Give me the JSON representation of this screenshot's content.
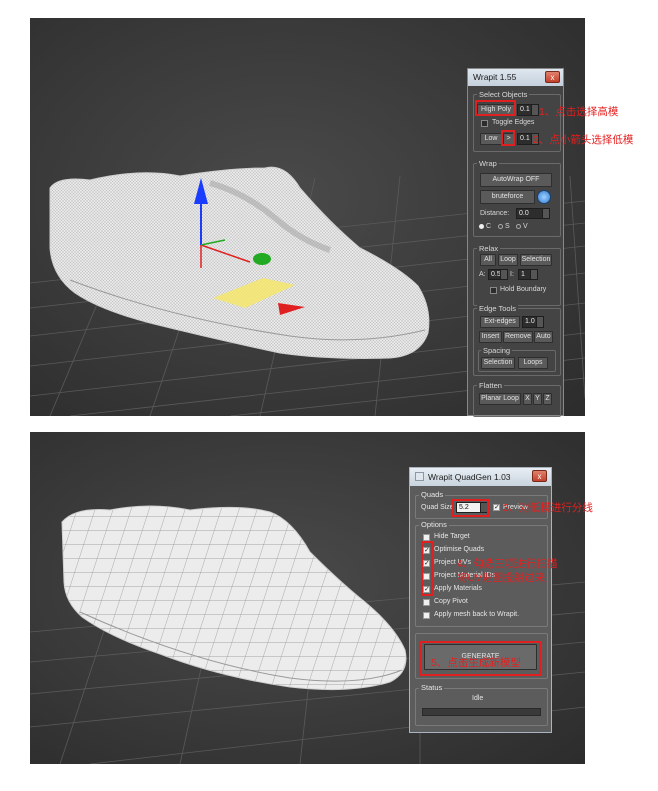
{
  "wrapit": {
    "title": "Wrapit 1.55",
    "close_glyph": "x",
    "select_objects": {
      "title": "Select Objects",
      "high_poly": "High Poly",
      "high_val": "0.1",
      "toggle_edges": "Toggle Edges",
      "low": "Low",
      "arrow": ">",
      "low_val": "0.1"
    },
    "wrap": {
      "title": "Wrap",
      "autowrap": "AutoWrap OFF",
      "bruteforce": "bruteforce",
      "distance_label": "Distance:",
      "distance_val": "0.0",
      "radio_c": "C",
      "radio_s": "S",
      "radio_v": "V"
    },
    "relax": {
      "title": "Relax",
      "all": "All",
      "loop": "Loop",
      "selection": "Selection",
      "a_label": "A:",
      "a_val": "0.5",
      "i_label": "I:",
      "i_val": "1",
      "hold_boundary": "Hold Boundary"
    },
    "edge_tools": {
      "title": "Edge Tools",
      "ext_edges": "Ext-edges",
      "ext_val": "1.0",
      "insert": "Insert",
      "remove": "Remove",
      "auto": "Auto",
      "spacing": "Spacing",
      "selection": "Selection",
      "loops": "Loops"
    },
    "flatten": {
      "title": "Flatten",
      "planar_loop": "Planar Loop",
      "x": "X",
      "y": "Y",
      "z": "Z"
    }
  },
  "quadgen": {
    "title": "Wrapit QuadGen 1.03",
    "close_glyph": "x",
    "quads_title": "Quads",
    "quad_size_label": "Quad Size",
    "quad_size_val": "5.2",
    "preview": "Preview",
    "options_title": "Options",
    "options": [
      {
        "label": "Hide Target",
        "checked": false
      },
      {
        "label": "Optimise Quads",
        "checked": true
      },
      {
        "label": "Project UVs",
        "checked": true
      },
      {
        "label": "Project Material IDs",
        "checked": false
      },
      {
        "label": "Apply Materials",
        "checked": true
      },
      {
        "label": "Copy Pivot",
        "checked": false
      },
      {
        "label": "Apply mesh back to Wrapit.",
        "checked": false
      }
    ],
    "generate": "GENERATE",
    "status_title": "Status",
    "status_val": "Idle"
  },
  "annotations": {
    "a1": "1、点击选择高模",
    "a2": "2、点小箭头选择低模",
    "a3": "3、对低模进行分线",
    "a4": "4、勾选三项进行扫描",
    "a4b": "将UV贴图投射过来",
    "a5": "5、点击生成新模型"
  },
  "colors": {
    "annotation": "#e51f1f",
    "viewport_bg": "#3a3a3a",
    "gizmo_y": "#1a3cff",
    "gizmo_z": "#22aa22",
    "gizmo_x": "#e02020",
    "gizmo_plane": "#f4e66a"
  }
}
